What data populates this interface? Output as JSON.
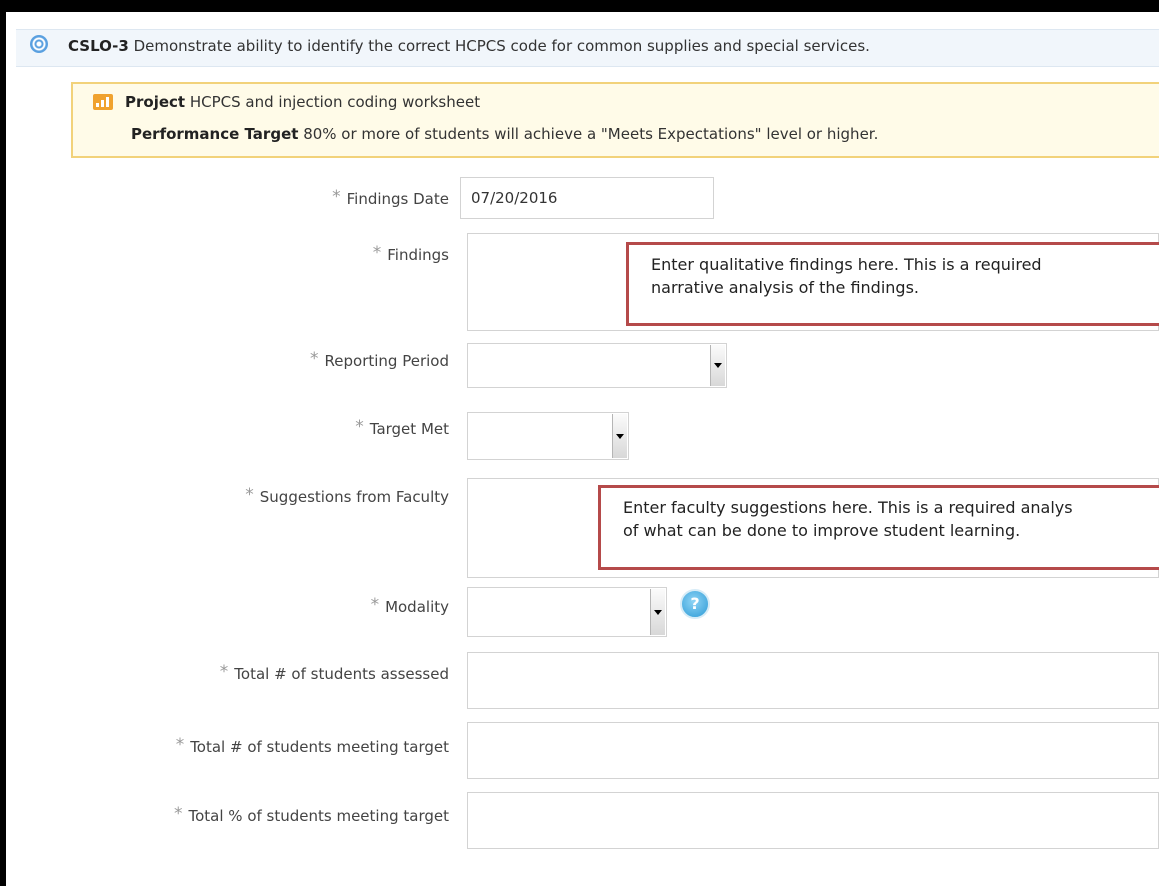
{
  "outcome": {
    "code": "CSLO-3",
    "description": "Demonstrate ability to identify the correct HCPCS code for common supplies and special services."
  },
  "project": {
    "label": "Project",
    "name": "HCPCS and injection coding worksheet",
    "target_label": "Performance Target",
    "target_text": "80% or more of students will achieve a \"Meets Expectations\" level or higher."
  },
  "icons": {
    "outcome": "target-icon",
    "project": "bar-chart-icon",
    "help": "help-icon",
    "dropdown": "chevron-down-icon"
  },
  "form": {
    "required_marker": "*",
    "findings_date": {
      "label": "Findings Date",
      "value": "07/20/2016"
    },
    "findings": {
      "label": "Findings",
      "note": [
        "Enter qualitative findings here. This is a required",
        "narrative analysis of the findings."
      ]
    },
    "reporting_period": {
      "label": "Reporting Period",
      "value": ""
    },
    "target_met": {
      "label": "Target Met",
      "value": ""
    },
    "suggestions": {
      "label": "Suggestions from Faculty",
      "note": [
        "Enter faculty suggestions here. This is a required analys",
        "of what can be done to improve student learning."
      ]
    },
    "modality": {
      "label": "Modality",
      "value": "",
      "help": "?"
    },
    "total_assessed": {
      "label": "Total # of students assessed",
      "value": ""
    },
    "total_meeting": {
      "label": "Total # of students meeting target",
      "value": ""
    },
    "total_pct": {
      "label": "Total % of students meeting target",
      "value": ""
    }
  },
  "colors": {
    "annotation_border": "#b54a4a",
    "project_border": "#f2d27a",
    "help_blue": "#2b9ad6"
  }
}
